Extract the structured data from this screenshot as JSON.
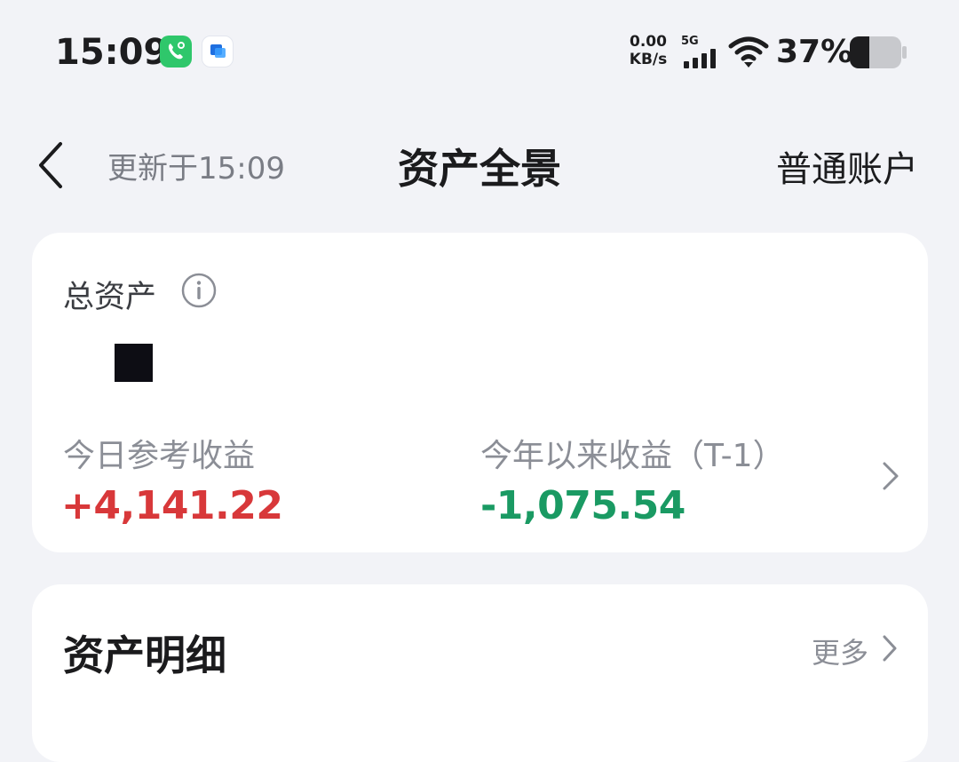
{
  "status_bar": {
    "time": "15:09",
    "net_speed_value": "0.00",
    "net_speed_unit": "KB/s",
    "network_type": "5G",
    "battery_percent": "37%",
    "battery_level": 0.37,
    "icons": [
      "call-app-icon",
      "chat-app-icon",
      "signal-icon",
      "wifi-icon",
      "battery-icon"
    ]
  },
  "nav": {
    "updated_text": "更新于15:09",
    "title": "资产全景",
    "account_label": "普通账户"
  },
  "total_card": {
    "label": "总资产",
    "today_label": "今日参考收益",
    "today_value": "+4,141.22",
    "year_label": "今年以来收益（T-1）",
    "year_value": "-1,075.54"
  },
  "detail_card": {
    "title": "资产明细",
    "more_label": "更多"
  },
  "colors": {
    "background": "#f2f3f7",
    "positive": "#d8383a",
    "negative": "#1a9a63"
  }
}
